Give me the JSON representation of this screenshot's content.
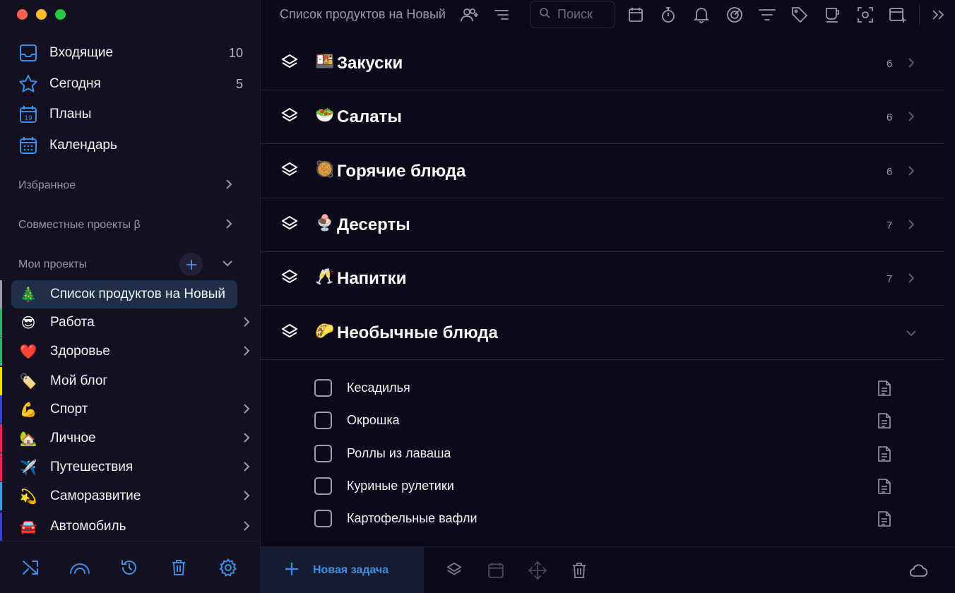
{
  "sidebar": {
    "nav": [
      {
        "label": "Входящие",
        "count": "10",
        "icon": "inbox-icon"
      },
      {
        "label": "Сегодня",
        "count": "5",
        "icon": "star-icon"
      },
      {
        "label": "Планы",
        "count": "",
        "icon": "calendar-day-icon"
      },
      {
        "label": "Календарь",
        "count": "",
        "icon": "calendar-icon"
      }
    ],
    "sections": {
      "favorites": "Избранное",
      "shared": "Совместные проекты β",
      "my_projects": "Мои проекты"
    },
    "projects": [
      {
        "emoji": "🎄",
        "label": "Список продуктов на Новый",
        "color": "#9b9aa8",
        "active": true
      },
      {
        "emoji": "😎",
        "label": "Работа",
        "color": "#2bb673"
      },
      {
        "emoji": "❤️",
        "label": "Здоровье",
        "color": "#2bb673"
      },
      {
        "emoji": "🏷️",
        "label": "Мой блог",
        "color": "#f5d90a"
      },
      {
        "emoji": "💪",
        "label": "Спорт",
        "color": "#3b3fd8"
      },
      {
        "emoji": "🏡",
        "label": "Личное",
        "color": "#e0245e"
      },
      {
        "emoji": "✈️",
        "label": "Путешествия",
        "color": "#e0245e"
      },
      {
        "emoji": "💫",
        "label": "Саморазвитие",
        "color": "#3a9ee8"
      },
      {
        "emoji": "🚘",
        "label": "Автомобиль",
        "color": "#3b3fd8"
      }
    ],
    "footer_icons": [
      "shuffle-icon",
      "arc-icon",
      "history-icon",
      "trash-icon",
      "settings-icon"
    ]
  },
  "main": {
    "title": "Список продуктов на Новый",
    "search_placeholder": "Поиск",
    "groups": [
      {
        "emoji": "🍱",
        "label": "Закуски",
        "count": "6"
      },
      {
        "emoji": "🥗",
        "label": "Салаты",
        "count": "6"
      },
      {
        "emoji": "🥘",
        "label": "Горячие блюда",
        "count": "6"
      },
      {
        "emoji": "🍨",
        "label": "Десерты",
        "count": "7"
      },
      {
        "emoji": "🥂",
        "label": "Напитки",
        "count": "7"
      },
      {
        "emoji": "🌮",
        "label": "Необычные блюда",
        "count": ""
      }
    ],
    "tasks": [
      "Кесадилья",
      "Окрошка",
      "Роллы из лаваша",
      "Куриные рулетики",
      "Картофельные вафли"
    ],
    "new_task_label": "Новая задача"
  },
  "colors": {
    "accent": "#3f8fe8",
    "sidebar_bg": "#13111f",
    "main_bg": "#0c0a18",
    "active_row": "#202f4a"
  }
}
